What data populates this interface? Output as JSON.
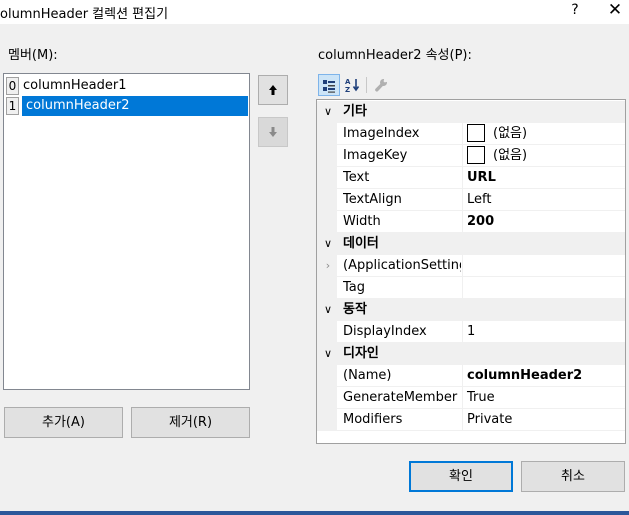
{
  "window": {
    "title": "olumnHeader 컬렉션 편집기",
    "help": "?",
    "close": "✕"
  },
  "members": {
    "label": "멤버(M):",
    "items": [
      {
        "index": "0",
        "name": "columnHeader1",
        "selected": false
      },
      {
        "index": "1",
        "name": "columnHeader2",
        "selected": true
      }
    ],
    "up_icon": "arrow-up-icon",
    "down_icon": "arrow-down-icon",
    "add_label": "추가(A)",
    "remove_label": "제거(R)"
  },
  "properties": {
    "label": "columnHeader2 속성(P):",
    "toolbar": [
      "categorized-icon",
      "alphabetical-icon",
      "property-pages-icon"
    ],
    "rows": [
      {
        "type": "category",
        "name": "기타"
      },
      {
        "type": "prop",
        "name": "ImageIndex",
        "value": "(없음)",
        "swatch": true
      },
      {
        "type": "prop",
        "name": "ImageKey",
        "value": "(없음)",
        "swatch": true
      },
      {
        "type": "prop",
        "name": "Text",
        "value": "URL",
        "bold": true
      },
      {
        "type": "prop",
        "name": "TextAlign",
        "value": "Left"
      },
      {
        "type": "prop",
        "name": "Width",
        "value": "200",
        "bold": true
      },
      {
        "type": "category",
        "name": "데이터"
      },
      {
        "type": "prop",
        "name": "(ApplicationSetting",
        "value": "",
        "expandable": true
      },
      {
        "type": "prop",
        "name": "Tag",
        "value": ""
      },
      {
        "type": "category",
        "name": "동작"
      },
      {
        "type": "prop",
        "name": "DisplayIndex",
        "value": "1"
      },
      {
        "type": "category",
        "name": "디자인"
      },
      {
        "type": "prop",
        "name": "(Name)",
        "value": "columnHeader2",
        "bold": true
      },
      {
        "type": "prop",
        "name": "GenerateMember",
        "value": "True"
      },
      {
        "type": "prop",
        "name": "Modifiers",
        "value": "Private"
      }
    ]
  },
  "buttons": {
    "ok": "확인",
    "cancel": "취소"
  },
  "colors": {
    "selection": "#0078d7",
    "accent_bar": "#2b579a"
  }
}
